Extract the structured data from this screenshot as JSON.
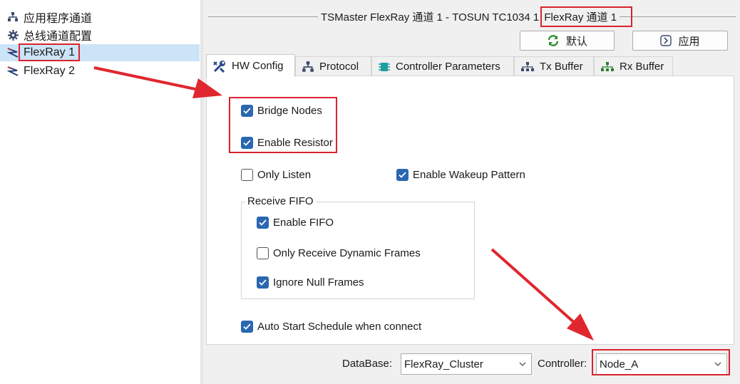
{
  "tree": {
    "items": [
      {
        "label": "应用程序通道",
        "icon": "network-icon"
      },
      {
        "label": "总线通道配置",
        "icon": "gear-icon"
      },
      {
        "label": "FlexRay 1",
        "icon": "flexray-icon",
        "selected": true
      },
      {
        "label": "FlexRay 2",
        "icon": "flexray-icon"
      }
    ]
  },
  "header": {
    "title_prefix": "TSMaster FlexRay 通道 1 - TOSUN TC1034 1",
    "title_highlight": "FlexRay 通道 1"
  },
  "toolbar": {
    "default_label": "默认",
    "apply_label": "应用"
  },
  "tabs": [
    {
      "label": "HW Config",
      "icon": "tools-icon",
      "active": true
    },
    {
      "label": "Protocol",
      "icon": "network-icon"
    },
    {
      "label": "Controller Parameters",
      "icon": "chip-icon"
    },
    {
      "label": "Tx Buffer",
      "icon": "tree-icon"
    },
    {
      "label": "Rx Buffer",
      "icon": "tree-icon"
    }
  ],
  "hw_config": {
    "bridge_nodes": {
      "label": "Bridge Nodes",
      "checked": true
    },
    "enable_resistor": {
      "label": "Enable Resistor",
      "checked": true
    },
    "only_listen": {
      "label": "Only Listen",
      "checked": false
    },
    "enable_wakeup_pattern": {
      "label": "Enable Wakeup Pattern",
      "checked": true
    },
    "receive_fifo": {
      "title": "Receive FIFO",
      "enable_fifo": {
        "label": "Enable FIFO",
        "checked": true
      },
      "only_receive_dynamic": {
        "label": "Only Receive Dynamic Frames",
        "checked": false
      },
      "ignore_null_frames": {
        "label": "Ignore Null Frames",
        "checked": true
      }
    },
    "auto_start": {
      "label": "Auto Start Schedule when connect",
      "checked": true
    }
  },
  "bottom": {
    "database_label": "DataBase:",
    "database_value": "FlexRay_Cluster",
    "controller_label": "Controller:",
    "controller_value": "Node_A"
  },
  "colors": {
    "accent": "#2a67b1",
    "highlight": "#d9232c",
    "selection": "#cce4f7"
  }
}
